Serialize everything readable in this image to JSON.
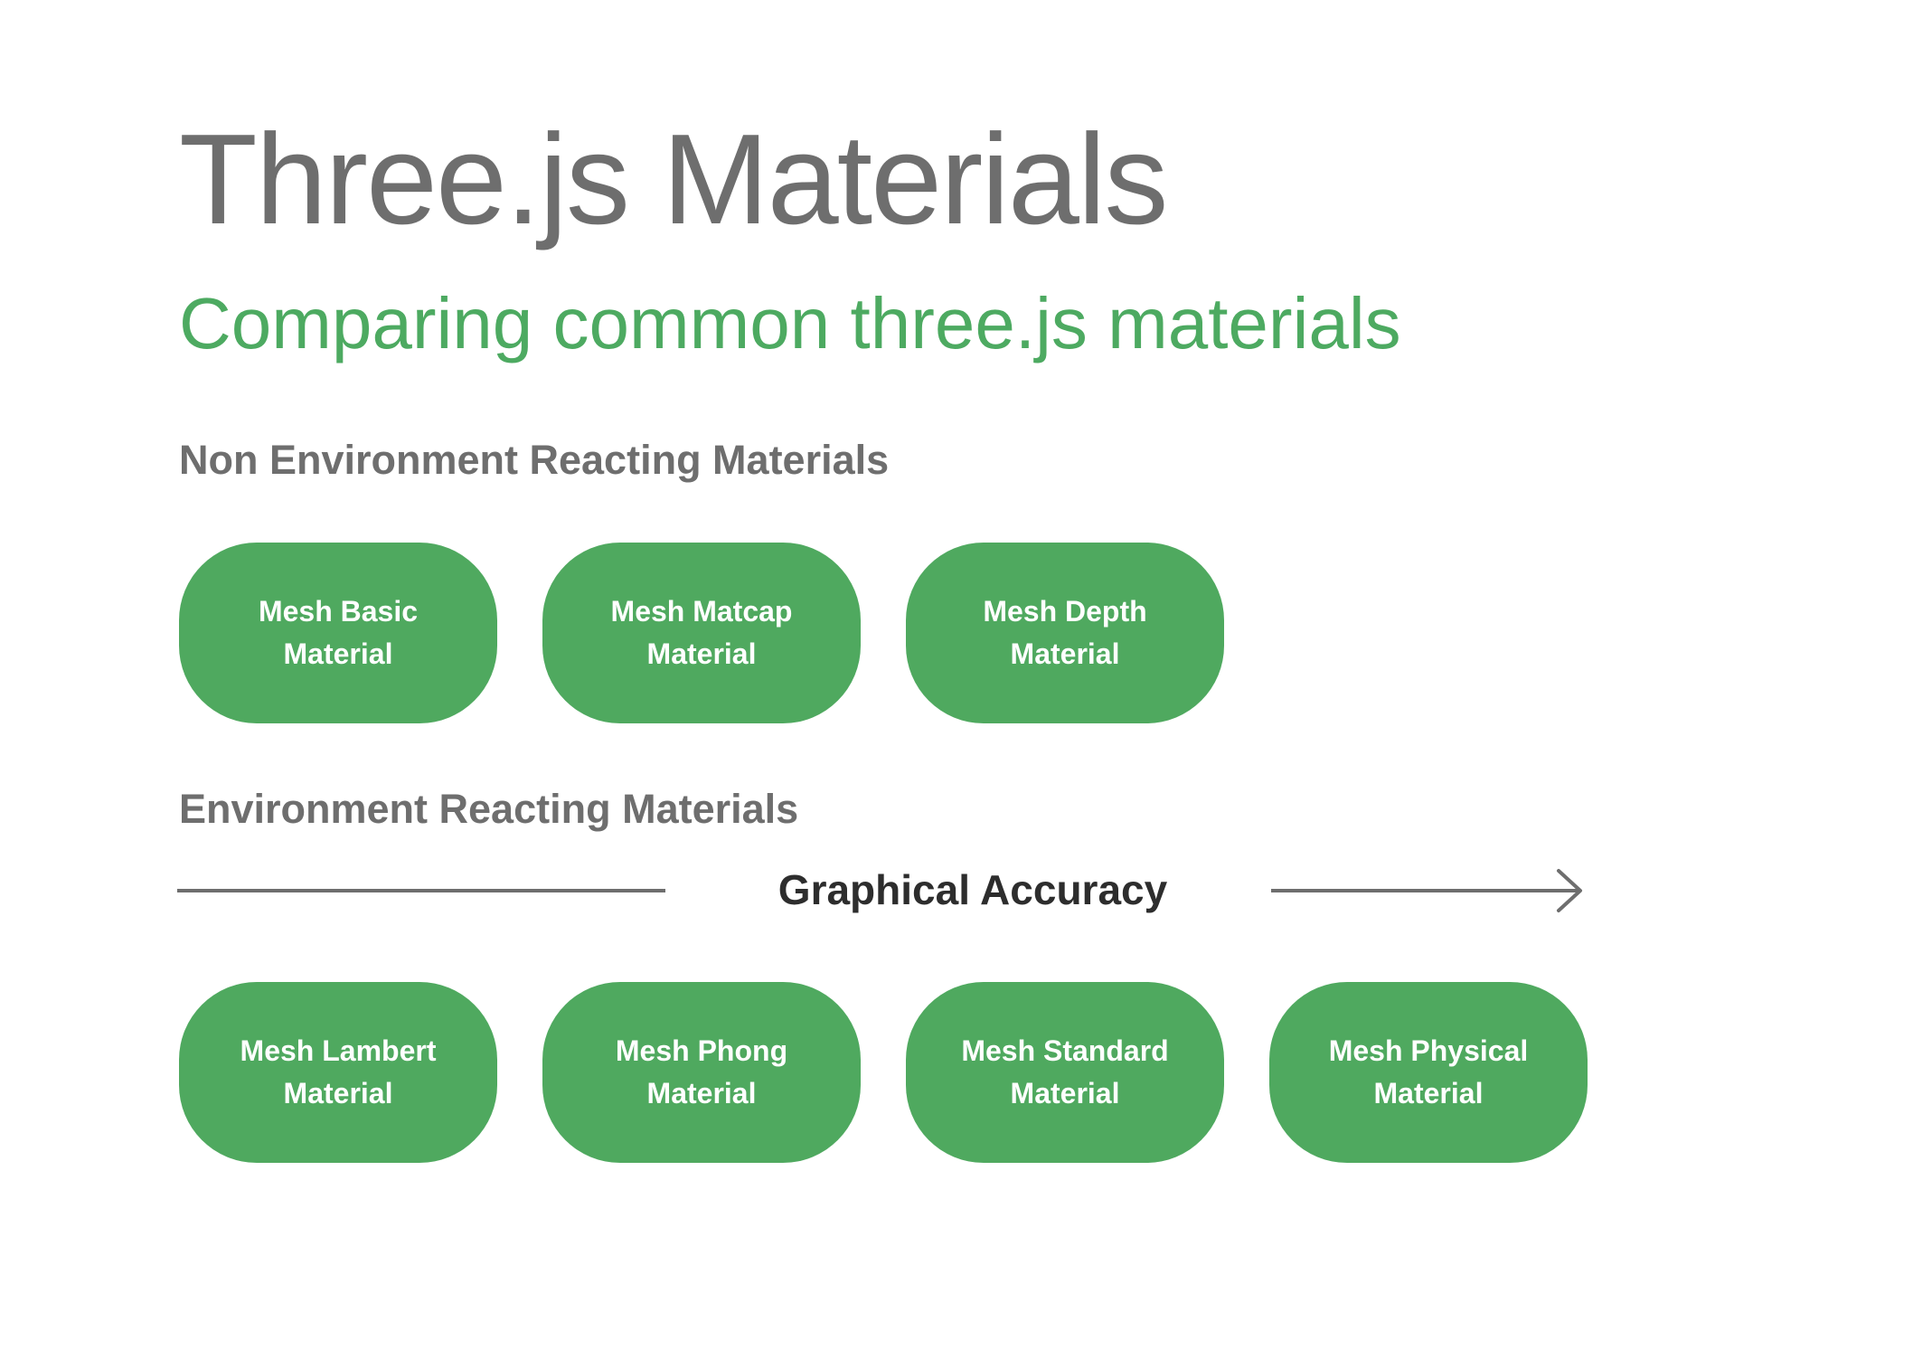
{
  "title": "Three.js Materials",
  "subtitle": "Comparing common three.js materials",
  "colors": {
    "title": "#6e6e6e",
    "subtitle": "#4daa61",
    "pill": "#4fa95f",
    "pill_text": "#ffffff",
    "axis_line": "#6e6e6e"
  },
  "non_environment": {
    "heading": "Non Environment Reacting Materials",
    "materials": [
      {
        "line1": "Mesh Basic",
        "line2": "Material"
      },
      {
        "line1": "Mesh Matcap",
        "line2": "Material"
      },
      {
        "line1": "Mesh Depth",
        "line2": "Material"
      }
    ]
  },
  "environment": {
    "heading": "Environment Reacting Materials",
    "axis_label": "Graphical Accuracy",
    "materials": [
      {
        "line1": "Mesh Lambert",
        "line2": "Material"
      },
      {
        "line1": "Mesh Phong",
        "line2": "Material"
      },
      {
        "line1": "Mesh Standard",
        "line2": "Material"
      },
      {
        "line1": "Mesh Physical",
        "line2": "Material"
      }
    ]
  }
}
